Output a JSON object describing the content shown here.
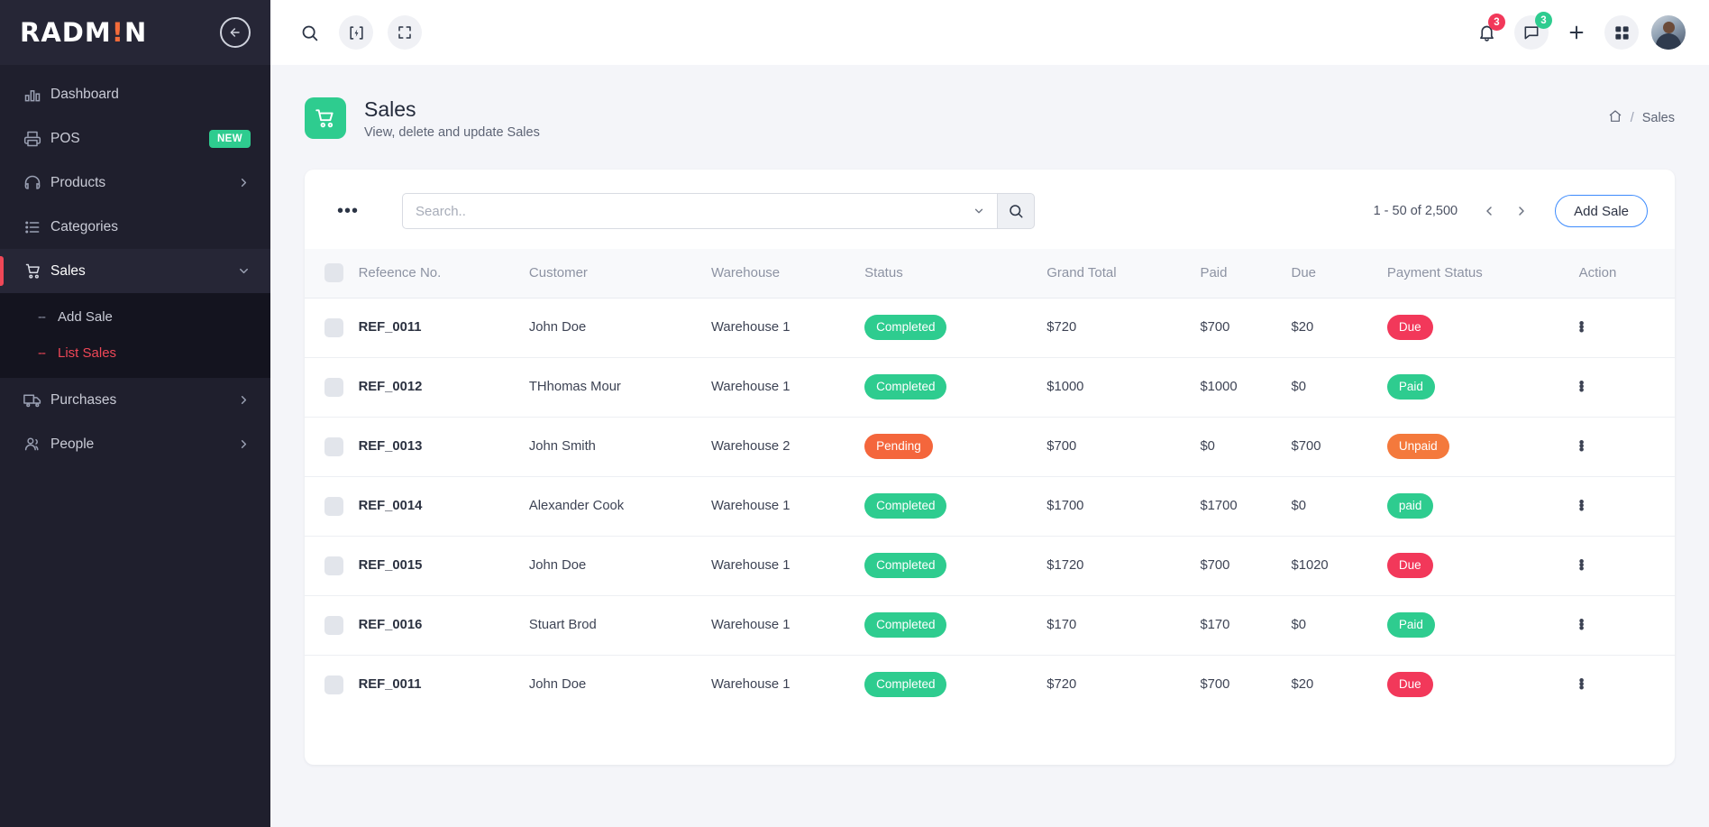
{
  "brand": {
    "name_left": "RADM",
    "name_accent": "!",
    "name_right": "N",
    "collapse_icon": "arrow-left-circle-icon"
  },
  "sidebar": {
    "items": [
      {
        "label": "Dashboard",
        "icon": "bar-chart-icon",
        "badge": null,
        "chevron": null,
        "active": false
      },
      {
        "label": "POS",
        "icon": "printer-icon",
        "badge": "NEW",
        "chevron": null,
        "active": false
      },
      {
        "label": "Products",
        "icon": "headphones-icon",
        "badge": null,
        "chevron": "chevron-right-icon",
        "active": false
      },
      {
        "label": "Categories",
        "icon": "list-icon",
        "badge": null,
        "chevron": null,
        "active": false
      },
      {
        "label": "Sales",
        "icon": "cart-icon",
        "badge": null,
        "chevron": "chevron-down-icon",
        "active": true
      },
      {
        "label": "Purchases",
        "icon": "truck-icon",
        "badge": null,
        "chevron": "chevron-right-icon",
        "active": false
      },
      {
        "label": "People",
        "icon": "users-icon",
        "badge": null,
        "chevron": "chevron-right-icon",
        "active": false
      }
    ],
    "submenu": [
      {
        "label": "Add Sale",
        "dash": "--",
        "active": false
      },
      {
        "label": "List Sales",
        "dash": "--",
        "active": true
      }
    ],
    "active_color": "#ef4757",
    "badge_color": "#2ecc8f"
  },
  "topbar": {
    "search_icon": "search-icon",
    "flash_icon": "flash-bracket-icon",
    "fullscreen_icon": "fullscreen-icon",
    "notifications_icon": "bell-icon",
    "notifications_count": "3",
    "messages_icon": "chat-icon",
    "messages_count": "3",
    "add_icon": "plus-icon",
    "apps_icon": "grid-apps-icon",
    "avatar": "user-avatar"
  },
  "page": {
    "icon": "cart-icon",
    "icon_color": "#2ecc8f",
    "title": "Sales",
    "subtitle": "View, delete and update Sales",
    "breadcrumb": {
      "home_icon": "home-icon",
      "separator": "/",
      "current": "Sales"
    }
  },
  "toolbar": {
    "more_icon": "ellipsis-icon",
    "search_placeholder": "Search..",
    "search_value": "",
    "search_caret_icon": "chevron-down-icon",
    "search_button_icon": "search-icon",
    "range_text": "1 - 50 of 2,500",
    "prev_icon": "chevron-left-icon",
    "next_icon": "chevron-right-icon",
    "add_label": "Add Sale",
    "add_border_color": "#3d8bfd"
  },
  "table": {
    "select_all": "select-all-checkbox",
    "columns": [
      "",
      "Refeence No.",
      "Customer",
      "Warehouse",
      "Status",
      "Grand Total",
      "Paid",
      "Due",
      "Payment Status",
      "Action"
    ],
    "rows": [
      {
        "ref": "REF_0011",
        "customer": "John Doe",
        "warehouse": "Warehouse 1",
        "status": "Completed",
        "status_color": "#2ecc8f",
        "grand_total": "$720",
        "paid": "$700",
        "due": "$20",
        "payment_status": "Due",
        "payment_color": "#f2385a",
        "action": "kebab-icon"
      },
      {
        "ref": "REF_0012",
        "customer": "THhomas Mour",
        "warehouse": "Warehouse 1",
        "status": "Completed",
        "status_color": "#2ecc8f",
        "grand_total": "$1000",
        "paid": "$1000",
        "due": "$0",
        "payment_status": "Paid",
        "payment_color": "#2ecc8f",
        "action": "kebab-icon"
      },
      {
        "ref": "REF_0013",
        "customer": "John Smith",
        "warehouse": "Warehouse 2",
        "status": "Pending",
        "status_color": "#f4663c",
        "grand_total": "$700",
        "paid": "$0",
        "due": "$700",
        "payment_status": "Unpaid",
        "payment_color": "#f4793c",
        "action": "kebab-icon"
      },
      {
        "ref": "REF_0014",
        "customer": "Alexander Cook",
        "warehouse": "Warehouse 1",
        "status": "Completed",
        "status_color": "#2ecc8f",
        "grand_total": "$1700",
        "paid": "$1700",
        "due": "$0",
        "payment_status": "paid",
        "payment_color": "#2ecc8f",
        "action": "kebab-icon"
      },
      {
        "ref": "REF_0015",
        "customer": "John Doe",
        "warehouse": "Warehouse 1",
        "status": "Completed",
        "status_color": "#2ecc8f",
        "grand_total": "$1720",
        "paid": "$700",
        "due": "$1020",
        "payment_status": "Due",
        "payment_color": "#f2385a",
        "action": "kebab-icon"
      },
      {
        "ref": "REF_0016",
        "customer": "Stuart Brod",
        "warehouse": "Warehouse 1",
        "status": "Completed",
        "status_color": "#2ecc8f",
        "grand_total": "$170",
        "paid": "$170",
        "due": "$0",
        "payment_status": "Paid",
        "payment_color": "#2ecc8f",
        "action": "kebab-icon"
      },
      {
        "ref": "REF_0011",
        "customer": "John Doe",
        "warehouse": "Warehouse 1",
        "status": "Completed",
        "status_color": "#2ecc8f",
        "grand_total": "$720",
        "paid": "$700",
        "due": "$20",
        "payment_status": "Due",
        "payment_color": "#f2385a",
        "action": "kebab-icon"
      }
    ]
  }
}
